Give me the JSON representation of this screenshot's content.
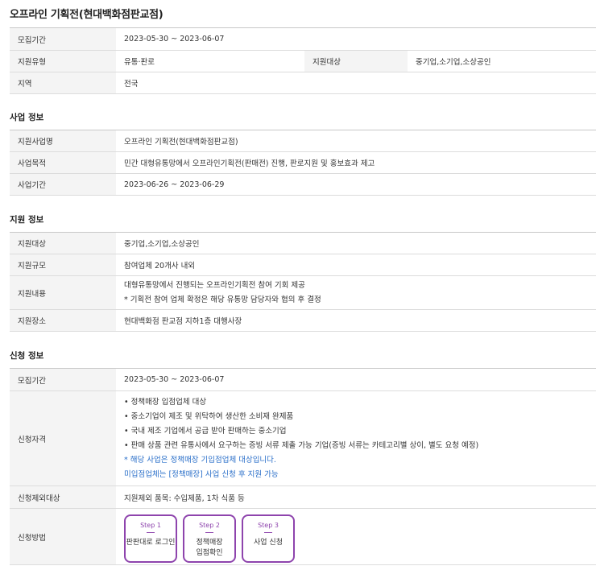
{
  "page_title": "오프라인 기획전(현대백화점판교점)",
  "summary": {
    "recruit_period_label": "모집기간",
    "recruit_period_value": "2023-05-30 ~ 2023-06-07",
    "support_type_label": "지원유형",
    "support_type_value": "유통·판로",
    "support_target_label": "지원대상",
    "support_target_value": "중기업,소기업,소상공인",
    "region_label": "지역",
    "region_value": "전국"
  },
  "business_info": {
    "title": "사업 정보",
    "rows": [
      {
        "label": "지원사업명",
        "value": "오프라인 기획전(현대백화점판교점)"
      },
      {
        "label": "사업목적",
        "value": "민간 대형유통망에서 오프라인기획전(판매전) 진행, 판로지원 및 홍보효과 제고"
      },
      {
        "label": "사업기간",
        "value": "2023-06-26 ~ 2023-06-29"
      }
    ]
  },
  "support_info": {
    "title": "지원 정보",
    "target_label": "지원대상",
    "target_value": "중기업,소기업,소상공인",
    "scale_label": "지원규모",
    "scale_value": "참여업체 20개사 내외",
    "content_label": "지원내용",
    "content_line1": "대형유통망에서 진행되는 오프라인기획전 참여 기회 제공",
    "content_line2": "* 기획전 참여 업체 확정은 해당 유통망 담당자와 협의 후 결정",
    "place_label": "지원장소",
    "place_value": "현대백화점 판교점 지하1층 대행사장"
  },
  "apply_info": {
    "title": "신청 정보",
    "period_label": "모집기간",
    "period_value": "2023-05-30 ~ 2023-06-07",
    "qual_label": "신청자격",
    "qual_items": [
      "• 정책매장 입점업체 대상",
      "• 중소기업이 제조 및 위탁하여 생산한 소비재 완제품",
      "• 국내 제조 기업에서 공급 받아 판매하는 중소기업",
      "• 판매 상품 관련 유통사에서 요구하는 증빙 서류 제출 가능 기업(증빙 서류는 카테고리별 상이, 별도 요청 예정)"
    ],
    "qual_note1": "* 해당 사업은 정책매장 기입점업체 대상입니다.",
    "qual_note2": "미입점업체는 [정책매장] 사업 신청 후 지원 가능",
    "exclude_label": "신청제외대상",
    "exclude_value": "지원제외 품목: 수입제품, 1차 식품 등",
    "method_label": "신청방법",
    "steps": [
      {
        "num": "Step 1",
        "label": "판판대로 로그인"
      },
      {
        "num": "Step 2",
        "label": "정책매장\n입점확인"
      },
      {
        "num": "Step 3",
        "label": "사업 신청"
      }
    ]
  }
}
